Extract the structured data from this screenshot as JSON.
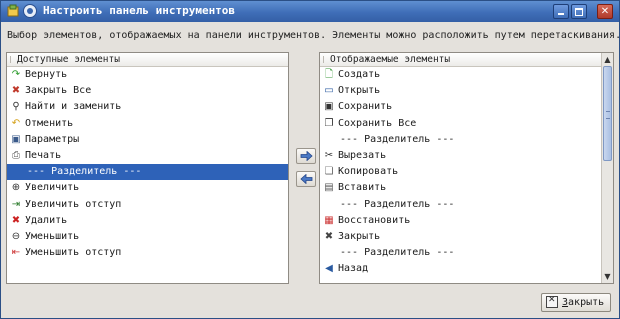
{
  "window": {
    "title": "Настроить панель инструментов",
    "buttons": {
      "minimize": "minimize",
      "maximize": "maximize",
      "close": "✕"
    }
  },
  "description": "Выбор элементов, отображаемых на панели инструментов. Элементы можно расположить путем перетаскивания.",
  "available": {
    "header": "Доступные элементы",
    "items": [
      {
        "label": "Вернуть",
        "icon": "redo-icon",
        "color": "#2a9a2a"
      },
      {
        "label": "Закрыть Все",
        "icon": "close-all-icon",
        "color": "#c0392b"
      },
      {
        "label": "Найти и заменить",
        "icon": "find-replace-icon",
        "color": "#333333"
      },
      {
        "label": "Отменить",
        "icon": "undo-icon",
        "color": "#d4a017"
      },
      {
        "label": "Параметры",
        "icon": "preferences-icon",
        "color": "#3a5a8a"
      },
      {
        "label": "Печать",
        "icon": "print-icon",
        "color": "#555555"
      },
      {
        "label": "--- Разделитель ---",
        "icon": "",
        "separator": true,
        "selected": true
      },
      {
        "label": "Увеличить",
        "icon": "zoom-in-icon",
        "color": "#333333"
      },
      {
        "label": "Увеличить отступ",
        "icon": "indent-icon",
        "color": "#2a7a2a"
      },
      {
        "label": "Удалить",
        "icon": "delete-icon",
        "color": "#cc2222"
      },
      {
        "label": "Уменьшить",
        "icon": "zoom-out-icon",
        "color": "#333333"
      },
      {
        "label": "Уменьшить отступ",
        "icon": "unindent-icon",
        "color": "#cc3333"
      }
    ]
  },
  "displayed": {
    "header": "Отображаемые элементы",
    "items": [
      {
        "label": "Создать",
        "icon": "new-document-icon",
        "color": "#3a9a3a"
      },
      {
        "label": "Открыть",
        "icon": "open-icon",
        "color": "#2a5aa0"
      },
      {
        "label": "Сохранить",
        "icon": "save-icon",
        "color": "#333333"
      },
      {
        "label": "Сохранить Все",
        "icon": "save-all-icon",
        "color": "#333333"
      },
      {
        "label": "--- Разделитель ---",
        "icon": "",
        "separator": true
      },
      {
        "label": "Вырезать",
        "icon": "cut-icon",
        "color": "#333333"
      },
      {
        "label": "Копировать",
        "icon": "copy-icon",
        "color": "#666666"
      },
      {
        "label": "Вставить",
        "icon": "paste-icon",
        "color": "#555555"
      },
      {
        "label": "--- Разделитель ---",
        "icon": "",
        "separator": true
      },
      {
        "label": "Восстановить",
        "icon": "revert-icon",
        "color": "#cc3333"
      },
      {
        "label": "Закрыть",
        "icon": "close-icon",
        "color": "#444444"
      },
      {
        "label": "--- Разделитель ---",
        "icon": "",
        "separator": true
      },
      {
        "label": "Назад",
        "icon": "back-icon",
        "color": "#2a5aa0"
      }
    ]
  },
  "footer": {
    "close_label_underlined": "З",
    "close_label_rest": "акрыть"
  },
  "colors": {
    "selection": "#2e62b8",
    "titlebar": "#3f6eb8"
  }
}
